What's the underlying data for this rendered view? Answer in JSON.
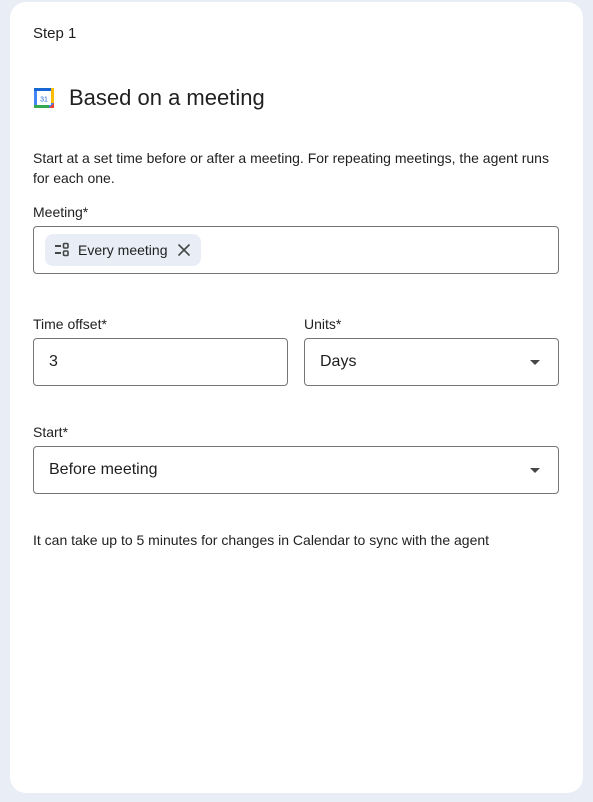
{
  "step": {
    "label": "Step 1"
  },
  "header": {
    "title": "Based on a meeting",
    "icon": "google-calendar-icon",
    "icon_day": "31"
  },
  "description": "Start at a set time before or after a meeting. For repeating meetings, the agent runs for each one.",
  "meeting": {
    "label": "Meeting*",
    "chip_label": "Every meeting",
    "chip_icon": "event-list-icon",
    "remove_icon": "close-icon"
  },
  "time_offset": {
    "label": "Time offset*",
    "value": "3"
  },
  "units": {
    "label": "Units*",
    "value": "Days"
  },
  "start": {
    "label": "Start*",
    "value": "Before meeting"
  },
  "footnote": "It can take up to 5 minutes for changes in Calendar to sync with the agent",
  "colors": {
    "page_bg": "#e9eef6",
    "card_bg": "#ffffff",
    "border": "#747775",
    "chip_bg": "#e9eef6",
    "text": "#1f1f1f"
  }
}
